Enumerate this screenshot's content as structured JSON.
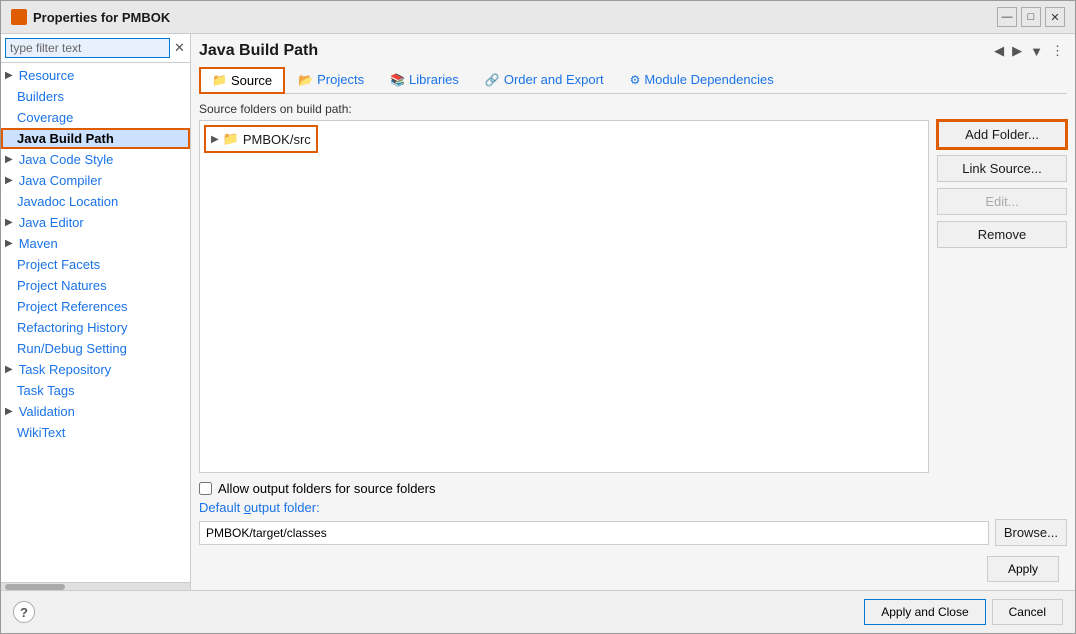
{
  "dialog": {
    "title": "Properties for PMBOK",
    "icon": "gear-icon"
  },
  "titleControls": {
    "minimize": "—",
    "maximize": "□",
    "close": "✕"
  },
  "sidebar": {
    "filter_placeholder": "type filter text",
    "items": [
      {
        "id": "resource",
        "label": "Resource",
        "has_arrow": true,
        "active": false
      },
      {
        "id": "builders",
        "label": "Builders",
        "has_arrow": false,
        "active": false
      },
      {
        "id": "coverage",
        "label": "Coverage",
        "has_arrow": false,
        "active": false
      },
      {
        "id": "java-build-path",
        "label": "Java Build Path",
        "has_arrow": false,
        "active": true
      },
      {
        "id": "java-code-style",
        "label": "Java Code Style",
        "has_arrow": true,
        "active": false
      },
      {
        "id": "java-compiler",
        "label": "Java Compiler",
        "has_arrow": true,
        "active": false
      },
      {
        "id": "javadoc-location",
        "label": "Javadoc Location",
        "has_arrow": false,
        "active": false
      },
      {
        "id": "java-editor",
        "label": "Java Editor",
        "has_arrow": true,
        "active": false
      },
      {
        "id": "maven",
        "label": "Maven",
        "has_arrow": true,
        "active": false
      },
      {
        "id": "project-facets",
        "label": "Project Facets",
        "has_arrow": false,
        "active": false
      },
      {
        "id": "project-natures",
        "label": "Project Natures",
        "has_arrow": false,
        "active": false
      },
      {
        "id": "project-references",
        "label": "Project References",
        "has_arrow": false,
        "active": false
      },
      {
        "id": "refactoring-history",
        "label": "Refactoring History",
        "has_arrow": false,
        "active": false
      },
      {
        "id": "run-debug-setting",
        "label": "Run/Debug Setting",
        "has_arrow": false,
        "active": false
      },
      {
        "id": "task-repository",
        "label": "Task Repository",
        "has_arrow": true,
        "active": false
      },
      {
        "id": "task-tags",
        "label": "Task Tags",
        "has_arrow": false,
        "active": false
      },
      {
        "id": "validation",
        "label": "Validation",
        "has_arrow": true,
        "active": false
      },
      {
        "id": "wikitext",
        "label": "WikiText",
        "has_arrow": false,
        "active": false
      }
    ]
  },
  "main": {
    "title": "Java Build Path",
    "tabs": [
      {
        "id": "source",
        "label": "Source",
        "icon": "📁",
        "active": true
      },
      {
        "id": "projects",
        "label": "Projects",
        "icon": "📂",
        "active": false
      },
      {
        "id": "libraries",
        "label": "Libraries",
        "icon": "📚",
        "active": false
      },
      {
        "id": "order-export",
        "label": "Order and Export",
        "icon": "🔗",
        "active": false
      },
      {
        "id": "module-dependencies",
        "label": "Module Dependencies",
        "icon": "⚙",
        "active": false
      }
    ],
    "section_label": "Source folders on build path:",
    "folders": [
      {
        "label": "PMBOK/src"
      }
    ],
    "buttons": [
      {
        "id": "add-folder",
        "label": "Add Folder...",
        "outlined": true
      },
      {
        "id": "link-source",
        "label": "Link Source...",
        "outlined": false
      },
      {
        "id": "edit",
        "label": "Edit...",
        "outlined": false,
        "disabled": true
      },
      {
        "id": "remove",
        "label": "Remove",
        "outlined": false
      }
    ],
    "allow_output_folders_label": "Allow output folders for source folders",
    "default_output_label": "Default output folder:",
    "default_output_value": "PMBOK/target/classes",
    "browse_label": "Browse...",
    "apply_label": "Apply"
  },
  "bottomBar": {
    "help_icon": "?",
    "apply_close_label": "Apply and Close",
    "cancel_label": "Cancel"
  }
}
